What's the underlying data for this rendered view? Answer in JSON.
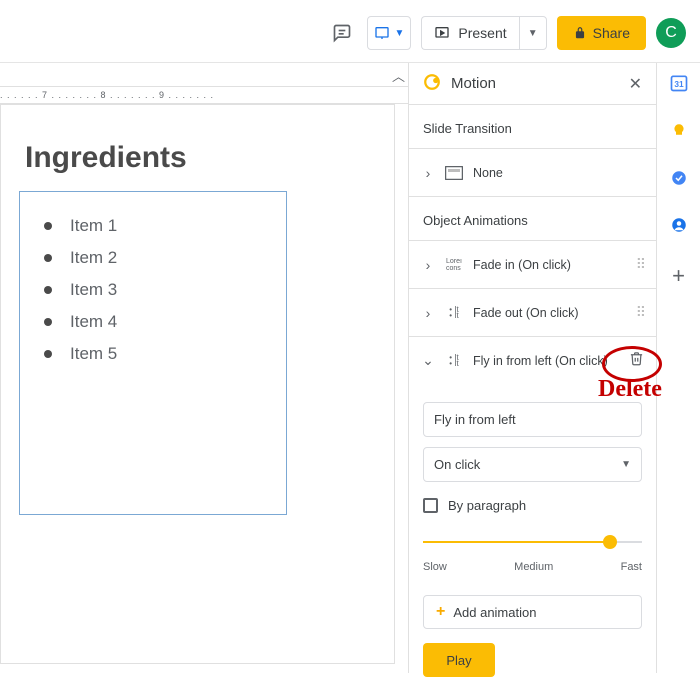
{
  "toolbar": {
    "present_label": "Present",
    "share_label": "Share",
    "avatar_initial": "C"
  },
  "ruler": {
    "marks": ". . . . . . 7 . . . . . . . 8 . . . . . . . 9 . . . . . . . "
  },
  "slide": {
    "title": "Ingredients",
    "items": [
      "Item 1",
      "Item 2",
      "Item 3",
      "Item 4",
      "Item 5"
    ]
  },
  "panel": {
    "title": "Motion",
    "section_transition": "Slide Transition",
    "transition_none": "None",
    "section_animations": "Object Animations",
    "anims": [
      {
        "label": "Fade in  (On click)"
      },
      {
        "label": "Fade out  (On click)"
      },
      {
        "label": "Fly in from left  (On click)"
      }
    ],
    "expanded": {
      "effect": "Fly in from left",
      "trigger": "On click",
      "by_paragraph": "By paragraph",
      "speed_slow": "Slow",
      "speed_med": "Medium",
      "speed_fast": "Fast"
    },
    "add_animation": "Add animation",
    "play": "Play"
  },
  "annotation": {
    "delete_label": "Delete"
  }
}
